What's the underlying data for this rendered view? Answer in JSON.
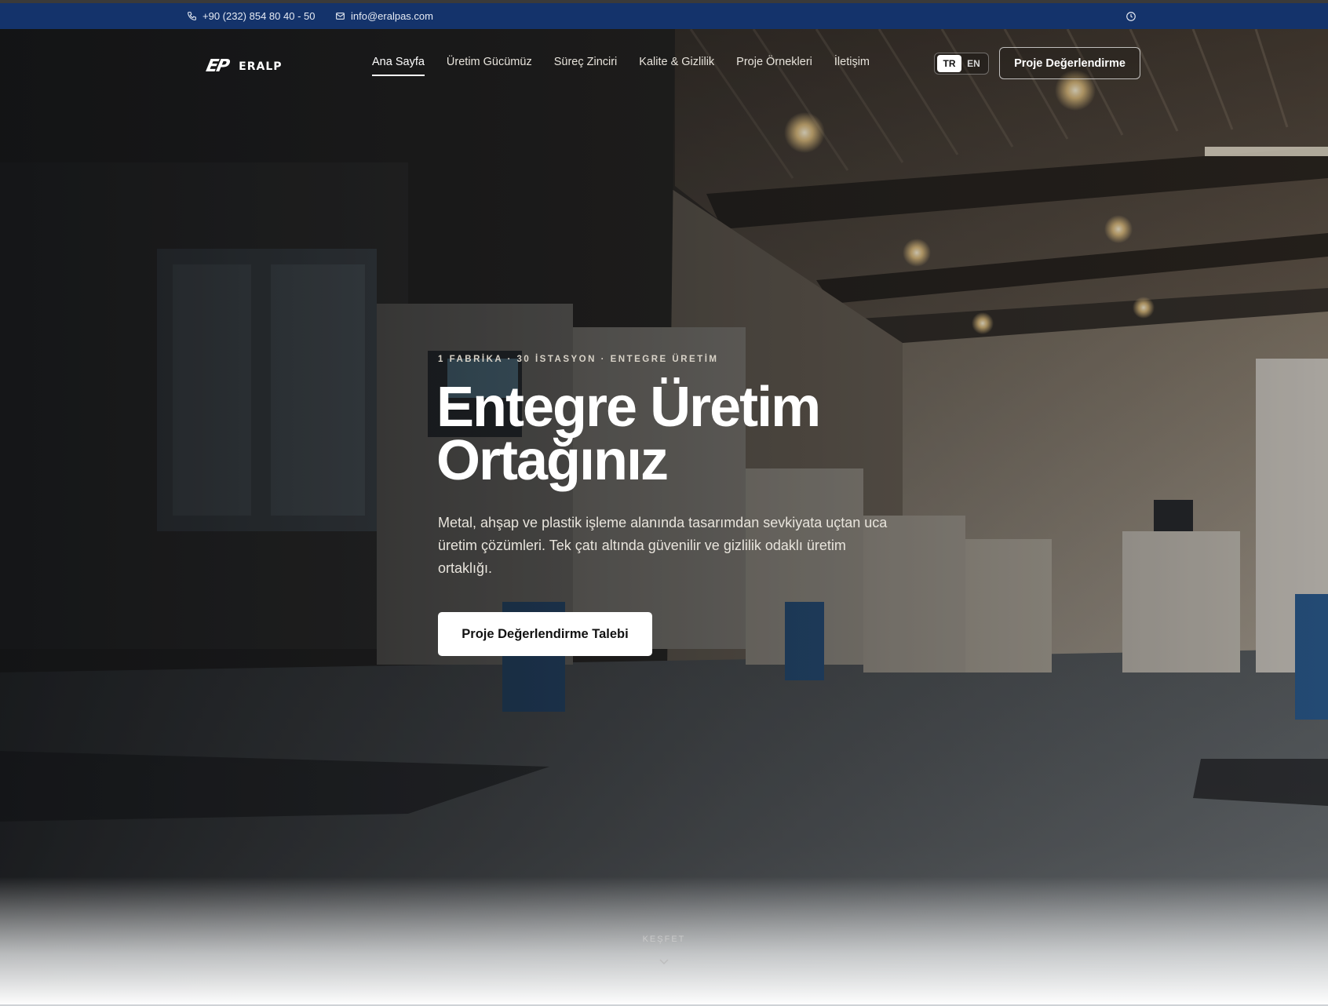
{
  "topbar": {
    "phone": "+90 (232) 854 80 40 - 50",
    "email": "info@eralpas.com",
    "icons": {
      "phone": "phone-icon",
      "email": "mail-icon",
      "clock": "clock-icon"
    },
    "bg_color": "#14336b"
  },
  "header": {
    "logo_mark": "EP",
    "logo_text": "ERALP",
    "nav": [
      {
        "label": "Ana Sayfa",
        "active": true
      },
      {
        "label": "Üretim Gücümüz",
        "active": false
      },
      {
        "label": "Süreç Zinciri",
        "active": false
      },
      {
        "label": "Kalite & Gizlilik",
        "active": false
      },
      {
        "label": "Proje Örnekleri",
        "active": false
      },
      {
        "label": "İletişim",
        "active": false
      }
    ],
    "lang": {
      "tr": "TR",
      "en": "EN",
      "selected": "TR"
    },
    "cta": "Proje Değerlendirme"
  },
  "hero": {
    "eyebrow": "1 FABRİKA · 30 İSTASYON · ENTEGRE ÜRETİM",
    "title_line1": "Entegre Üretim",
    "title_line2": "Ortağınız",
    "lead": "Metal, ahşap ve plastik işleme alanında tasarımdan sevkiyata uçtan uca üretim çözümleri. Tek çatı altında güvenilir ve gizlilik odaklı üretim ortaklığı.",
    "cta": "Proje Değerlendirme Talebi",
    "explore": "KEŞFET",
    "explore_icon": "chevron-down-icon"
  }
}
